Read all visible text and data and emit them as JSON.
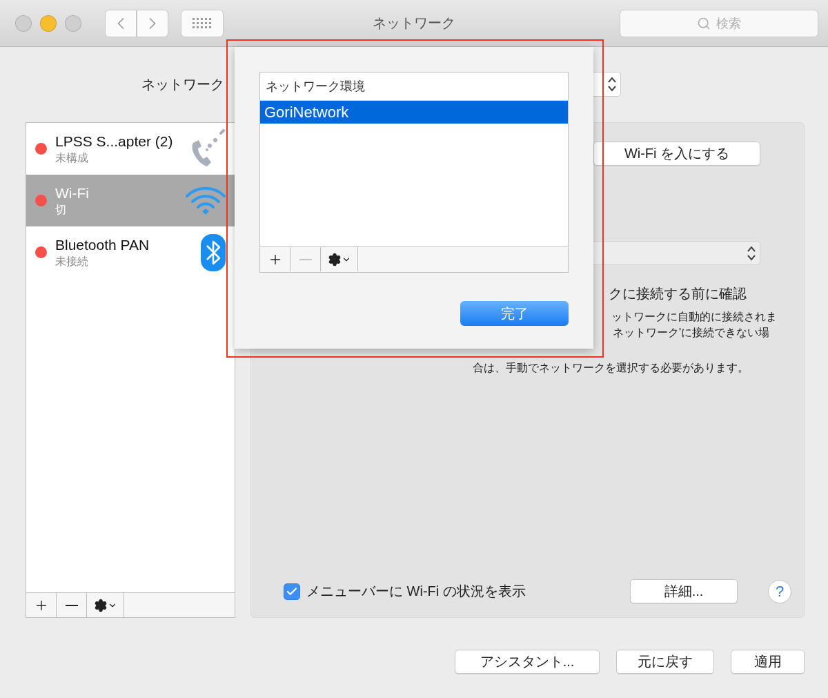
{
  "window": {
    "title": "ネットワーク",
    "search_placeholder": "検索"
  },
  "location": {
    "label": "ネットワーク"
  },
  "services": [
    {
      "name": "LPSS S...apter (2)",
      "status": "未構成",
      "kind": "phone",
      "selected": false
    },
    {
      "name": "Wi-Fi",
      "status": "切",
      "kind": "wifi",
      "selected": true
    },
    {
      "name": "Bluetooth PAN",
      "status": "未接続",
      "kind": "bluetooth",
      "selected": false
    }
  ],
  "wifi_button": "Wi-Fi を入にする",
  "ask_text": "クに接続する前に確認",
  "note_lines": [
    "ットワークに自動的に接続されま",
    "ネットワーク'に接続できない場",
    "合は、手動でネットワークを選択する必要があります。"
  ],
  "menu_checkbox": {
    "label": "メニューバーに Wi-Fi の状況を表示",
    "checked": true
  },
  "advanced_button": "詳細...",
  "help": "?",
  "footer_buttons": [
    "アシスタント...",
    "元に戻す",
    "適用"
  ],
  "sheet": {
    "list_header": "ネットワーク環境",
    "locations": [
      {
        "name": "GoriNetwork",
        "selected": true
      }
    ],
    "remove_disabled": true,
    "done": "完了"
  },
  "annotation": {
    "kind": "highlight-frame"
  }
}
